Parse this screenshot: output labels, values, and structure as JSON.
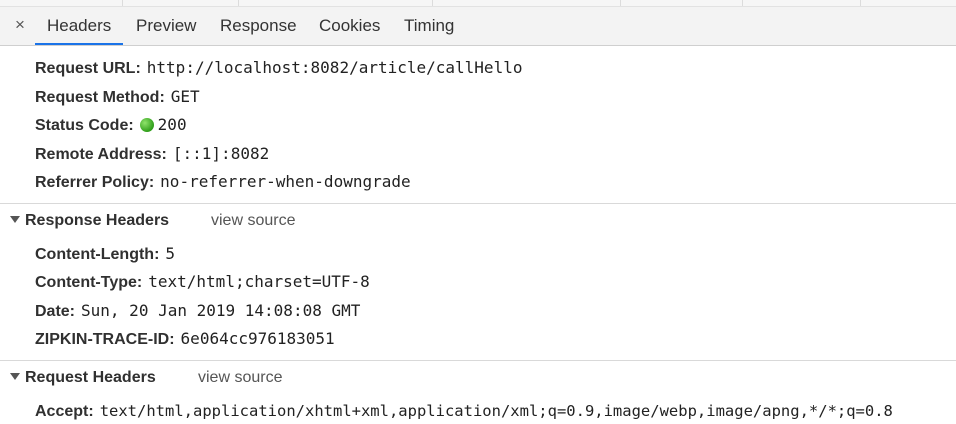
{
  "tabs": {
    "close_icon": "×",
    "items": [
      "Headers",
      "Preview",
      "Response",
      "Cookies",
      "Timing"
    ],
    "active": "Headers"
  },
  "general": [
    {
      "label": "Request URL:",
      "value": "http://localhost:8082/article/callHello"
    },
    {
      "label": "Request Method:",
      "value": "GET"
    },
    {
      "label": "Status Code:",
      "value": "200",
      "status_color": "#2f9e1a"
    },
    {
      "label": "Remote Address:",
      "value": "[::1]:8082"
    },
    {
      "label": "Referrer Policy:",
      "value": "no-referrer-when-downgrade"
    }
  ],
  "response_headers": {
    "title": "Response Headers",
    "view_source": "view source",
    "items": [
      {
        "label": "Content-Length:",
        "value": "5"
      },
      {
        "label": "Content-Type:",
        "value": "text/html;charset=UTF-8"
      },
      {
        "label": "Date:",
        "value": "Sun, 20 Jan 2019 14:08:08 GMT"
      },
      {
        "label": "ZIPKIN-TRACE-ID:",
        "value": "6e064cc976183051"
      }
    ]
  },
  "request_headers": {
    "title": "Request Headers",
    "view_source": "view source",
    "items": [
      {
        "label": "Accept:",
        "value": "text/html,application/xhtml+xml,application/xml;q=0.9,image/webp,image/apng,*/*;q=0.8"
      }
    ]
  }
}
